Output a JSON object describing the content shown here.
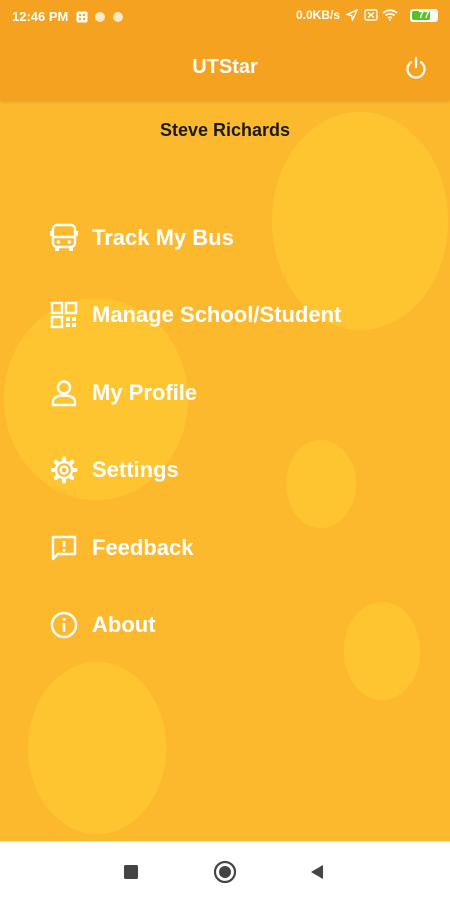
{
  "status_bar": {
    "time": "12:46 PM",
    "net_speed": "0.0KB/s",
    "battery": "77",
    "battery_level_pct": 77
  },
  "app_bar": {
    "title": "UTStar",
    "power_icon": "power-icon"
  },
  "drawer": {
    "user_name": "Steve Richards",
    "items": [
      {
        "label": "Track My Bus",
        "icon": "bus-icon"
      },
      {
        "label": "Manage School/Student",
        "icon": "dashboard-grid-icon"
      },
      {
        "label": "My Profile",
        "icon": "person-icon"
      },
      {
        "label": "Settings",
        "icon": "gear-icon"
      },
      {
        "label": "Feedback",
        "icon": "feedback-icon"
      },
      {
        "label": "About",
        "icon": "info-icon"
      }
    ]
  },
  "colors": {
    "app_bar": "#f4a21f",
    "drawer": "#fdb92e",
    "bubble": "#ffc531",
    "text_on_accent": "#ffffff",
    "user_name": "#1a1a1a",
    "battery": "#55c321"
  },
  "nav_bar": {
    "recents_icon": "square-icon",
    "home_icon": "circle-home-icon",
    "back_icon": "triangle-back-icon"
  }
}
